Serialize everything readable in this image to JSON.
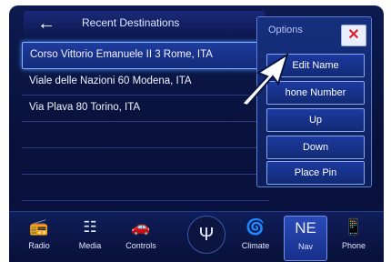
{
  "header": {
    "title": "Recent Destinations",
    "back_icon": "←"
  },
  "destinations": [
    "Corso Vittorio Emanuele II 3 Rome, ITA",
    "Viale delle Nazioni 60 Modena, ITA",
    "Via Plava 80 Torino, ITA"
  ],
  "options": {
    "title": "Options",
    "close_icon": "✕",
    "buttons": [
      "Edit Name",
      "hone Number",
      "Up",
      "Down",
      "Place Pin"
    ]
  },
  "bottom_bar": {
    "items": [
      {
        "label": "Radio",
        "icon": "📻"
      },
      {
        "label": "Media",
        "icon": "☷"
      },
      {
        "label": "Controls",
        "icon": "🚗"
      },
      {
        "label": "Climate",
        "icon": "🌀"
      },
      {
        "label": "Nav",
        "icon": "NE"
      },
      {
        "label": "Phone",
        "icon": "📱"
      }
    ],
    "logo_icon": "Ψ"
  },
  "colors": {
    "accent": "#7fb6ff",
    "close": "#e0202c"
  }
}
